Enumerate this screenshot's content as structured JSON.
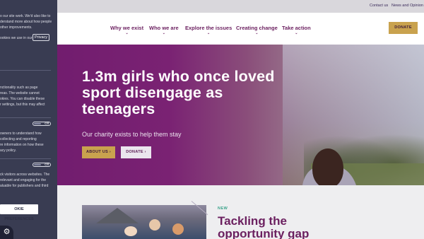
{
  "utility": {
    "contact": "Contact us",
    "news": "News and Opinion"
  },
  "nav": {
    "items": [
      {
        "label": "Why we exist"
      },
      {
        "label": "Who we are"
      },
      {
        "label": "Explore the issues"
      },
      {
        "label": "Creating change"
      },
      {
        "label": "Take action"
      }
    ],
    "chevron": "⌄",
    "donate": "DONATE"
  },
  "hero": {
    "title": "1.3m girls who once loved sport disengage as teenagers",
    "subtitle": "Our charity exists to help them stay",
    "about_btn": "ABOUT US ›",
    "donate_btn": "DONATE ›"
  },
  "section": {
    "tag": "NEW",
    "title": "Tackling the opportunity gap"
  },
  "cookie": {
    "intro_lines": [
      "o our site work. We'd also like to",
      "derstand more about how people",
      "other improvements."
    ],
    "privacy_line": "ookies we use in our",
    "privacy_btn": "Privacy",
    "block1": [
      "nctionality such as page",
      "reas. The website cannot",
      "okies. You can disable these",
      "r settings, but this may affect"
    ],
    "block2": [
      "owners to understand how",
      "collecting and reporting",
      "re information on how these",
      "acy policy."
    ],
    "block3": [
      "ck visitors across websites. The",
      "relevant and engaging for the",
      "aluable for publishers and third"
    ],
    "toggle_label": "Off",
    "pref_btn": "OKIE PREFERENCES",
    "gear_icon": "gear-icon"
  },
  "colors": {
    "brand_purple": "#6b1f5f",
    "gold": "#c9a24e",
    "cookie_bg": "#393c52"
  }
}
